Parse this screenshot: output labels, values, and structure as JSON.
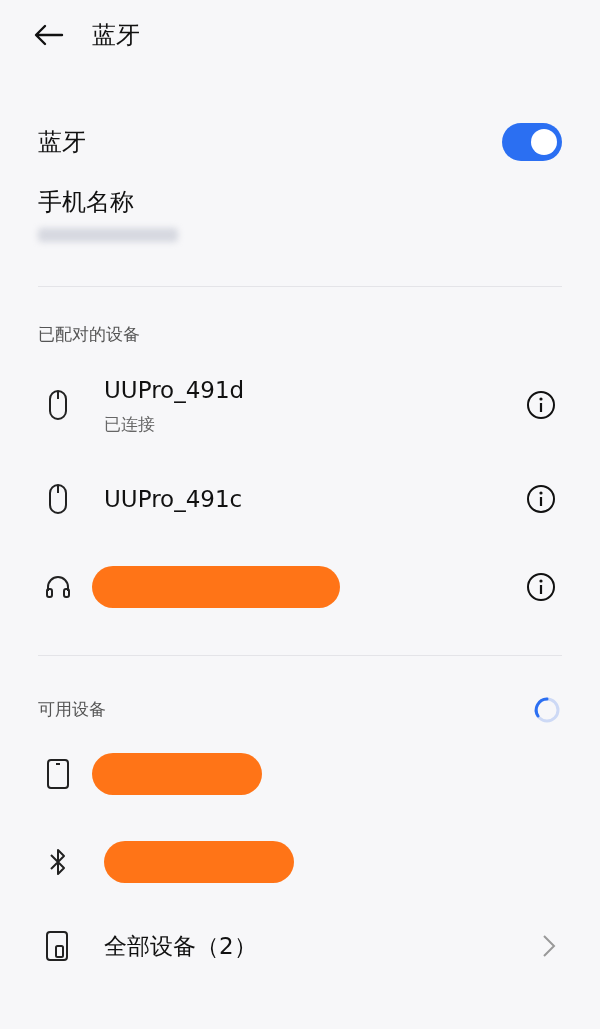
{
  "header": {
    "title": "蓝牙"
  },
  "bluetooth": {
    "label": "蓝牙",
    "on": true
  },
  "phone_name": {
    "label": "手机名称",
    "redacted": true
  },
  "paired": {
    "heading": "已配对的设备",
    "devices": [
      {
        "kind": "mouse",
        "name": "UUPro_491d",
        "status": "已连接"
      },
      {
        "kind": "mouse",
        "name": "UUPro_491c"
      },
      {
        "kind": "headset",
        "redacted": true
      }
    ]
  },
  "available": {
    "heading": "可用设备",
    "scanning": true,
    "devices": [
      {
        "kind": "phone",
        "redacted": true
      },
      {
        "kind": "bluetooth",
        "redacted": true
      }
    ]
  },
  "all_devices": {
    "label": "全部设备（2）"
  }
}
